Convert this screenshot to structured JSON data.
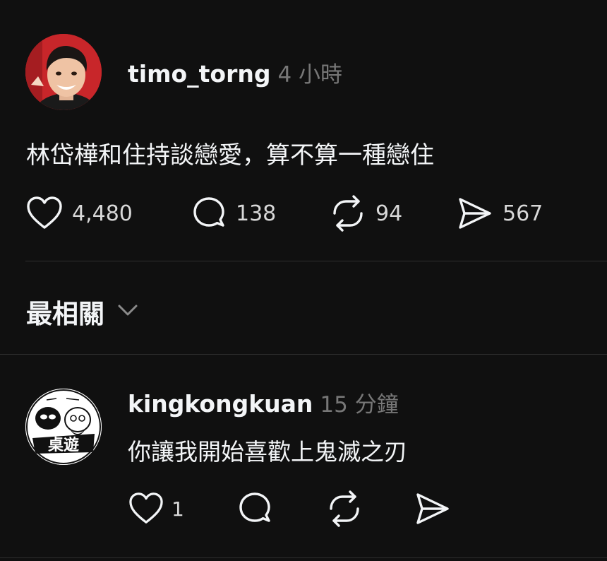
{
  "post": {
    "username": "timo_torng",
    "time": "4 小時",
    "text": "林岱樺和住持談戀愛，算不算一種戀住",
    "likes": "4,480",
    "comments": "138",
    "reposts": "94",
    "shares": "567"
  },
  "sort": {
    "label": "最相關"
  },
  "reply": {
    "username": "kingkongkuan",
    "time": "15 分鐘",
    "text": "你讓我開始喜歡上鬼滅之刃",
    "likes": "1",
    "avatar_text": "桌遊"
  },
  "colors": {
    "background": "#101010",
    "text": "#f3f5f7",
    "muted": "#777777",
    "divider": "#2e2e2e"
  }
}
